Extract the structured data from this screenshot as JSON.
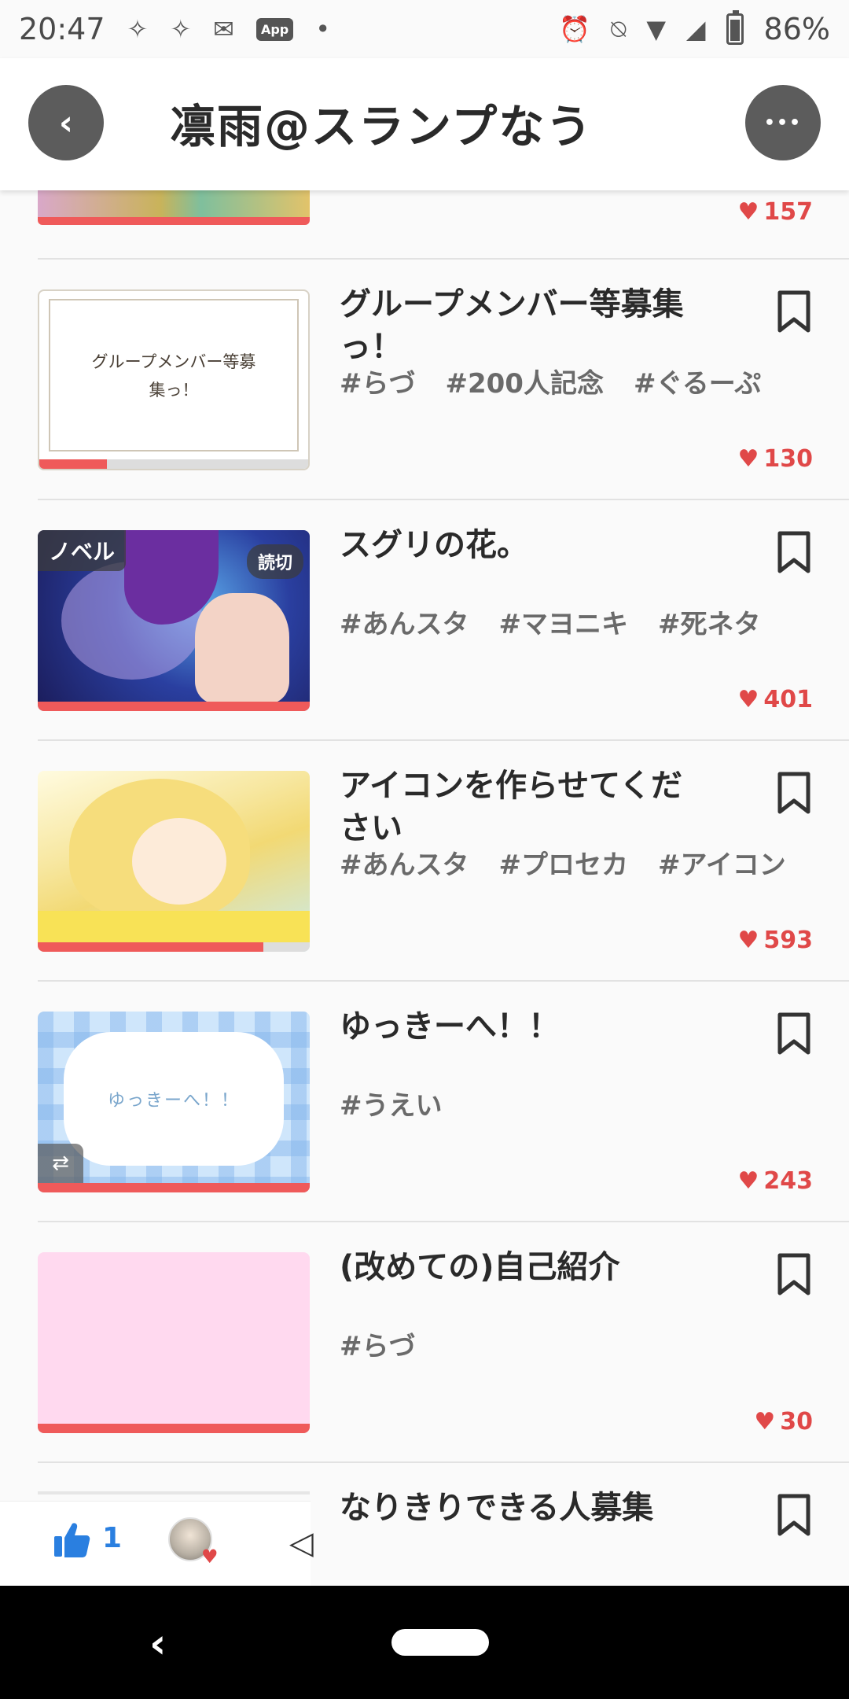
{
  "status_bar": {
    "time": "20:47",
    "battery": "86%",
    "app_badge": "App"
  },
  "header": {
    "title": "凛雨@スランプなう",
    "back_icon": "‹",
    "more_icon": "•••"
  },
  "partial_top": {
    "likes": "157"
  },
  "items": [
    {
      "title": "グループメンバー等募集っ！",
      "thumb_caption": "グループメンバー等募\n集っ！",
      "tags": [
        "#らづ",
        "#200人記念",
        "#ぐるーぷ"
      ],
      "likes": "130",
      "progress": 0.25
    },
    {
      "title": "スグリの花。",
      "thumb_label": "ノベル",
      "thumb_badge": "読切",
      "tags": [
        "#あんスタ",
        "#マヨニキ",
        "#死ネタ"
      ],
      "likes": "401",
      "progress": 1.0
    },
    {
      "title": "アイコンを作らせてください",
      "tags": [
        "#あんスタ",
        "#プロセカ",
        "#アイコン"
      ],
      "likes": "593",
      "progress": 0.83
    },
    {
      "title": "ゆっきーへ！！",
      "thumb_caption": "ゆっきーへ！！",
      "tags": [
        "#うえい"
      ],
      "likes": "243",
      "progress": 1.0
    },
    {
      "title": "(改めての)自己紹介",
      "tags": [
        "#らづ"
      ],
      "likes": "30",
      "progress": 1.0
    }
  ],
  "partial_bottom": {
    "title": "なりきりできる人募集"
  },
  "float_bar": {
    "like_count": "1"
  },
  "colors": {
    "accent": "#ef5a5a",
    "like": "#e04848",
    "thumbs": "#2a7fe0"
  }
}
